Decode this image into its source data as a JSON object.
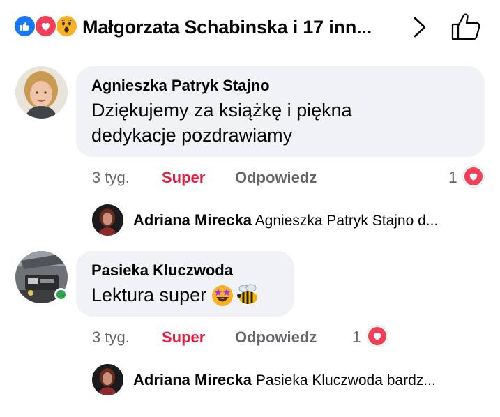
{
  "header": {
    "reactions": [
      "like-icon",
      "love-icon",
      "wow-icon"
    ],
    "title": "Małgorzata Schabinska i 17 inn..."
  },
  "comments": [
    {
      "author": "Agnieszka Patryk Stajno",
      "text_line1": "Dziękujemy za książkę i piękna",
      "text_line2": "dedykacje pozdrawiamy",
      "time": "3 tyg.",
      "reaction": "Super",
      "reply_label": "Odpowiedz",
      "reaction_count": "1",
      "reply": {
        "author": "Adriana Mirecka",
        "preview": "Agnieszka Patryk Stajno d..."
      }
    },
    {
      "author": "Pasieka Kluczwoda",
      "text": "Lektura super",
      "emojis": [
        "star-struck-emoji",
        "bee-emoji"
      ],
      "time": "3 tyg.",
      "reaction": "Super",
      "reply_label": "Odpowiedz",
      "reaction_count": "1",
      "online": true,
      "reply": {
        "author": "Adriana Mirecka",
        "preview": "Pasieka Kluczwoda bardz..."
      }
    }
  ],
  "colors": {
    "like": "#1877f2",
    "love": "#f33e58",
    "wow": "#f7b125",
    "super_text": "#e41e3f",
    "meta_text": "#65676b",
    "bubble": "#f0f2f5",
    "online": "#31a24c"
  }
}
